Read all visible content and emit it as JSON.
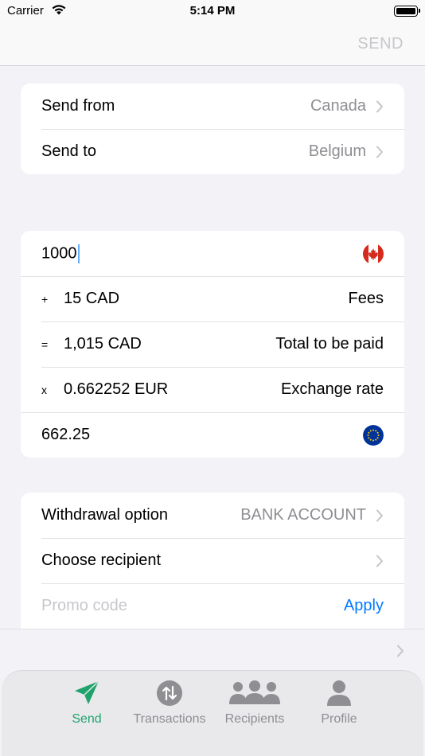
{
  "status": {
    "carrier": "Carrier",
    "time": "5:14 PM"
  },
  "nav": {
    "send_label": "SEND"
  },
  "route": [
    {
      "label": "Send from",
      "value": "Canada"
    },
    {
      "label": "Send to",
      "value": "Belgium"
    }
  ],
  "amount": {
    "input_value": "1000",
    "fees": {
      "symbol": "+",
      "value": "15 CAD",
      "label": "Fees"
    },
    "total": {
      "symbol": "=",
      "value": "1,015 CAD",
      "label": "Total to be paid"
    },
    "rate": {
      "symbol": "x",
      "value": "0.662252 EUR",
      "label": "Exchange rate"
    },
    "received": "662.25"
  },
  "options": {
    "withdrawal_label": "Withdrawal option",
    "withdrawal_value": "BANK ACCOUNT",
    "recipient_label": "Choose recipient",
    "promo_placeholder": "Promo code",
    "apply_label": "Apply"
  },
  "tabs": [
    {
      "label": "Send",
      "icon": "paper-plane-icon",
      "active": true
    },
    {
      "label": "Transactions",
      "icon": "transfer-arrows-icon",
      "active": false
    },
    {
      "label": "Recipients",
      "icon": "people-group-icon",
      "active": false
    },
    {
      "label": "Profile",
      "icon": "person-icon",
      "active": false
    }
  ],
  "colors": {
    "accent": "#1fa36b",
    "link": "#007aff",
    "placeholder": "#c7c7cc",
    "secondary": "#8e8e93"
  }
}
